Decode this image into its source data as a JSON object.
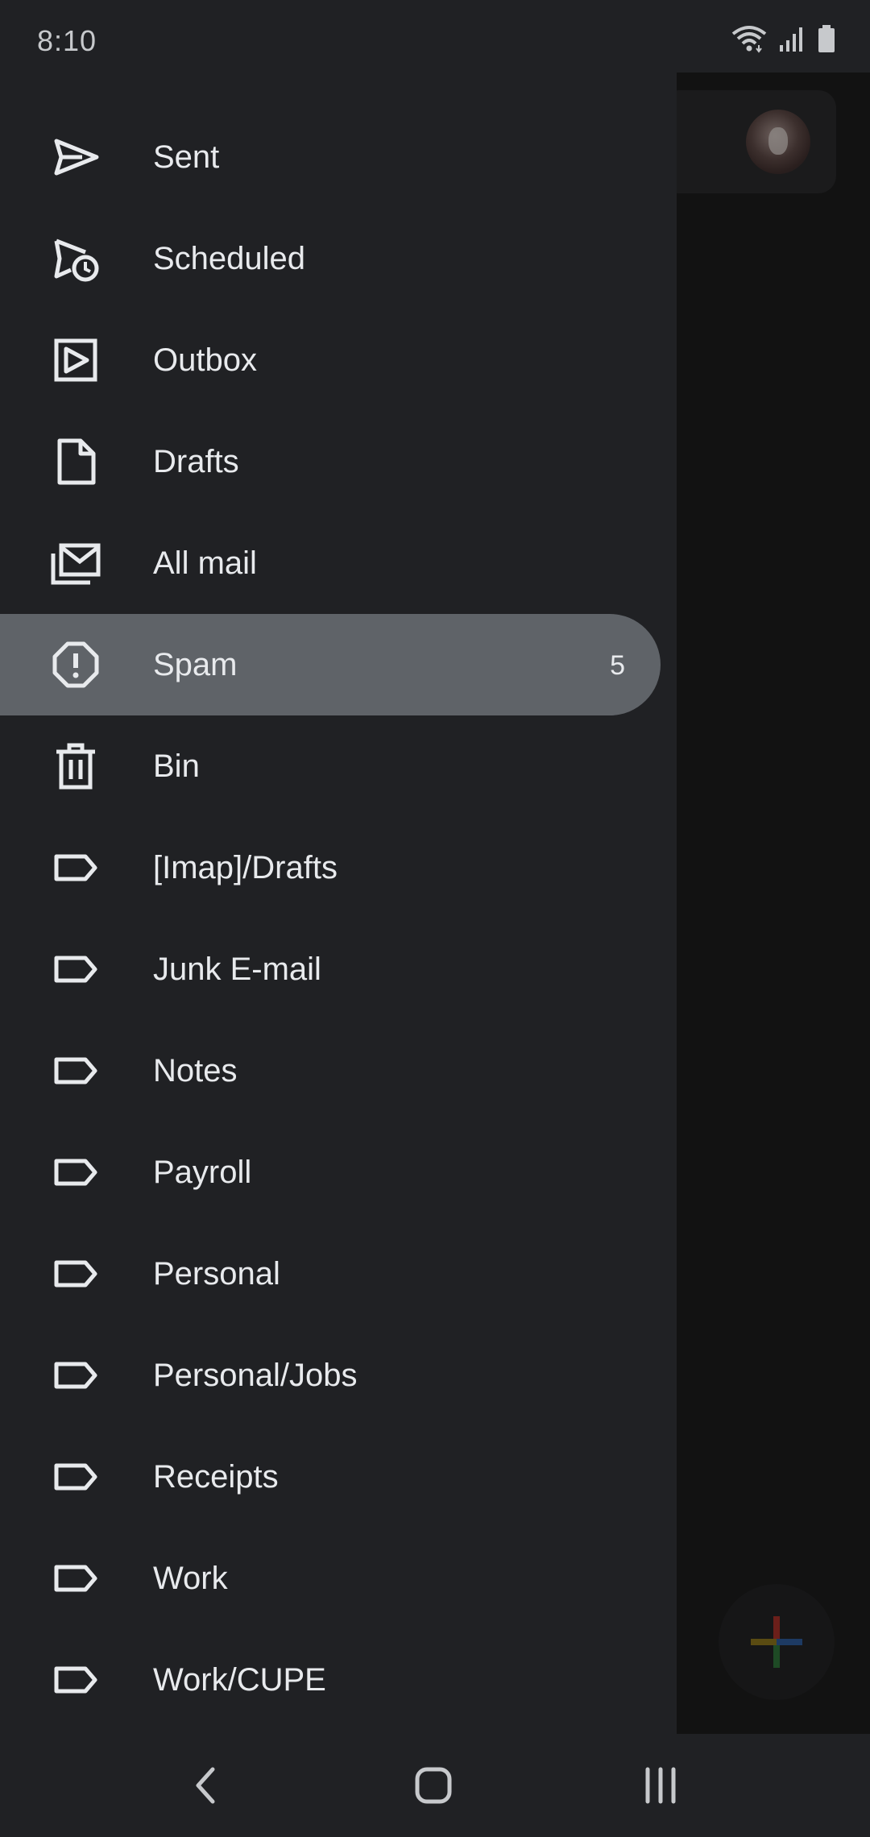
{
  "status_bar": {
    "time": "8:10",
    "icons": [
      "wifi-icon",
      "signal-icon",
      "battery-icon"
    ]
  },
  "drawer": {
    "cut_off_item_glyph": "|",
    "items": [
      {
        "label": "Sent",
        "icon": "send-icon",
        "count": "",
        "selected": false
      },
      {
        "label": "Scheduled",
        "icon": "scheduled-send-icon",
        "count": "",
        "selected": false
      },
      {
        "label": "Outbox",
        "icon": "outbox-icon",
        "count": "",
        "selected": false
      },
      {
        "label": "Drafts",
        "icon": "draft-icon",
        "count": "",
        "selected": false
      },
      {
        "label": "All mail",
        "icon": "all-mail-icon",
        "count": "",
        "selected": false
      },
      {
        "label": "Spam",
        "icon": "spam-icon",
        "count": "5",
        "selected": true
      },
      {
        "label": "Bin",
        "icon": "trash-icon",
        "count": "",
        "selected": false
      },
      {
        "label": "[Imap]/Drafts",
        "icon": "label-icon",
        "count": "",
        "selected": false
      },
      {
        "label": "Junk E-mail",
        "icon": "label-icon",
        "count": "",
        "selected": false
      },
      {
        "label": "Notes",
        "icon": "label-icon",
        "count": "",
        "selected": false
      },
      {
        "label": "Payroll",
        "icon": "label-icon",
        "count": "",
        "selected": false
      },
      {
        "label": "Personal",
        "icon": "label-icon",
        "count": "",
        "selected": false
      },
      {
        "label": "Personal/Jobs",
        "icon": "label-icon",
        "count": "",
        "selected": false
      },
      {
        "label": "Receipts",
        "icon": "label-icon",
        "count": "",
        "selected": false
      },
      {
        "label": "Work",
        "icon": "label-icon",
        "count": "",
        "selected": false
      },
      {
        "label": "Work/CUPE",
        "icon": "label-icon",
        "count": "",
        "selected": false
      }
    ]
  },
  "background_app": {
    "avatar": "account-avatar",
    "fab_icon": "compose-plus-icon"
  },
  "nav_bar": {
    "buttons": [
      "back-icon",
      "home-icon",
      "recents-icon"
    ]
  },
  "colors": {
    "drawer_bg": "#202124",
    "selected_bg": "#5f6368",
    "text": "#e8eaed",
    "scrim": "#121212"
  }
}
